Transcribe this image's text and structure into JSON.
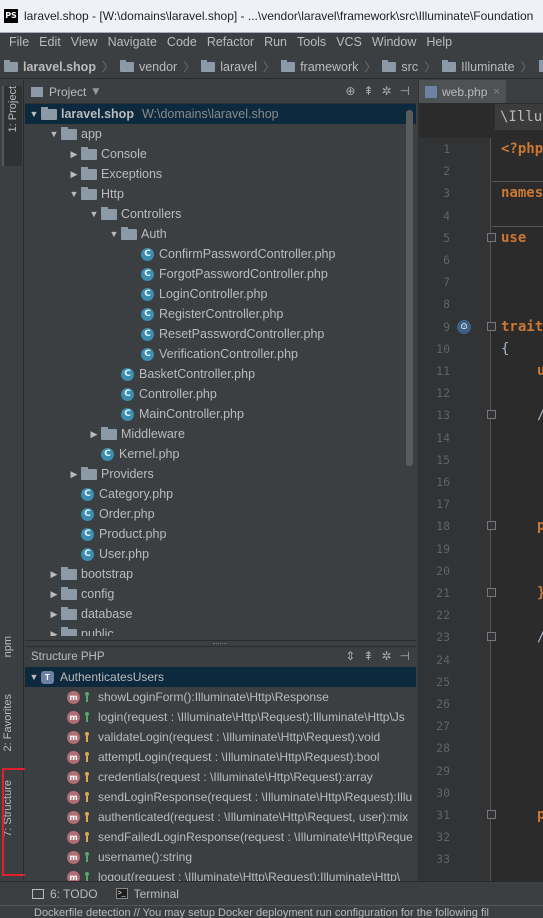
{
  "window": {
    "app_logo": "PS",
    "title": "laravel.shop - [W:\\domains\\laravel.shop] - ...\\vendor\\laravel\\framework\\src\\Illuminate\\Foundation"
  },
  "menu": [
    "File",
    "Edit",
    "View",
    "Navigate",
    "Code",
    "Refactor",
    "Run",
    "Tools",
    "VCS",
    "Window",
    "Help"
  ],
  "breadcrumbs": [
    "laravel.shop",
    "vendor",
    "laravel",
    "framework",
    "src",
    "Illuminate",
    "Foundation"
  ],
  "left_strip": {
    "project_tab": "1: Project",
    "npm_tab": "npm",
    "favorites_tab": "2: Favorites",
    "structure_tab": "7: Structure"
  },
  "project_panel": {
    "title": "Project",
    "root": {
      "name": "laravel.shop",
      "path": "W:\\domains\\laravel.shop"
    },
    "tree": [
      {
        "label": "app",
        "type": "folder",
        "expanded": true
      },
      {
        "label": "Console",
        "type": "folder",
        "expanded": false
      },
      {
        "label": "Exceptions",
        "type": "folder",
        "expanded": false
      },
      {
        "label": "Http",
        "type": "folder",
        "expanded": true
      },
      {
        "label": "Controllers",
        "type": "folder",
        "expanded": true
      },
      {
        "label": "Auth",
        "type": "folder",
        "expanded": true
      },
      {
        "label": "ConfirmPasswordController.php",
        "type": "php"
      },
      {
        "label": "ForgotPasswordController.php",
        "type": "php"
      },
      {
        "label": "LoginController.php",
        "type": "php"
      },
      {
        "label": "RegisterController.php",
        "type": "php"
      },
      {
        "label": "ResetPasswordController.php",
        "type": "php"
      },
      {
        "label": "VerificationController.php",
        "type": "php"
      },
      {
        "label": "BasketController.php",
        "type": "php"
      },
      {
        "label": "Controller.php",
        "type": "php"
      },
      {
        "label": "MainController.php",
        "type": "php"
      },
      {
        "label": "Middleware",
        "type": "folder",
        "expanded": false
      },
      {
        "label": "Kernel.php",
        "type": "php"
      },
      {
        "label": "Providers",
        "type": "folder",
        "expanded": false
      },
      {
        "label": "Category.php",
        "type": "php"
      },
      {
        "label": "Order.php",
        "type": "php"
      },
      {
        "label": "Product.php",
        "type": "php"
      },
      {
        "label": "User.php",
        "type": "php"
      },
      {
        "label": "bootstrap",
        "type": "folder",
        "expanded": false
      },
      {
        "label": "config",
        "type": "folder",
        "expanded": false
      },
      {
        "label": "database",
        "type": "folder",
        "expanded": false
      },
      {
        "label": "public",
        "type": "folder",
        "expanded": false
      }
    ]
  },
  "structure_panel": {
    "title": "Structure PHP",
    "trait": "AuthenticatesUsers",
    "members": [
      {
        "label": "showLoginForm():Illuminate\\Http\\Response",
        "visibility": "public"
      },
      {
        "label": "login(request : \\Illuminate\\Http\\Request):Illuminate\\Http\\Js",
        "visibility": "public"
      },
      {
        "label": "validateLogin(request : \\Illuminate\\Http\\Request):void",
        "visibility": "protected"
      },
      {
        "label": "attemptLogin(request : \\Illuminate\\Http\\Request):bool",
        "visibility": "protected"
      },
      {
        "label": "credentials(request : \\Illuminate\\Http\\Request):array",
        "visibility": "protected"
      },
      {
        "label": "sendLoginResponse(request : \\Illuminate\\Http\\Request):Illu",
        "visibility": "protected"
      },
      {
        "label": "authenticated(request : \\Illuminate\\Http\\Request, user):mix",
        "visibility": "protected"
      },
      {
        "label": "sendFailedLoginResponse(request : \\Illuminate\\Http\\Reque",
        "visibility": "protected"
      },
      {
        "label": "username():string",
        "visibility": "public"
      },
      {
        "label": "logout(request : \\Illuminate\\Http\\Request):Illuminate\\Http\\",
        "visibility": "public"
      }
    ]
  },
  "editor": {
    "tabs": [
      {
        "label": "web.php",
        "active": true
      }
    ],
    "crumb": "\\Illu",
    "line_numbers": [
      "1",
      "2",
      "3",
      "4",
      "5",
      "6",
      "7",
      "8",
      "9",
      "10",
      "11",
      "12",
      "13",
      "14",
      "15",
      "16",
      "17",
      "18",
      "19",
      "20",
      "21",
      "22",
      "23",
      "24",
      "25",
      "26",
      "27",
      "28",
      "29",
      "30",
      "31",
      "32",
      "33"
    ],
    "code": [
      {
        "line": 1,
        "kind": "kw",
        "text": "<?php"
      },
      {
        "line": 3,
        "kind": "kw",
        "text": "names"
      },
      {
        "line": 5,
        "kind": "kw",
        "text": "use"
      },
      {
        "line": 9,
        "kind": "kw",
        "text": "trait"
      },
      {
        "line": 10,
        "kind": "plain",
        "text": "{"
      },
      {
        "line": 11,
        "kind": "kw",
        "text": "u"
      },
      {
        "line": 13,
        "kind": "plain",
        "text": "/"
      },
      {
        "line": 18,
        "kind": "kw",
        "text": "p"
      },
      {
        "line": 21,
        "kind": "kw",
        "text": "}"
      },
      {
        "line": 23,
        "kind": "plain",
        "text": "/"
      },
      {
        "line": 31,
        "kind": "kw",
        "text": "p"
      }
    ]
  },
  "bottom_bar": {
    "todo": "6: TODO",
    "terminal": "Terminal"
  },
  "status_bar": {
    "text": "Dockerfile detection // You may setup Docker deployment run configuration for the following fil"
  }
}
